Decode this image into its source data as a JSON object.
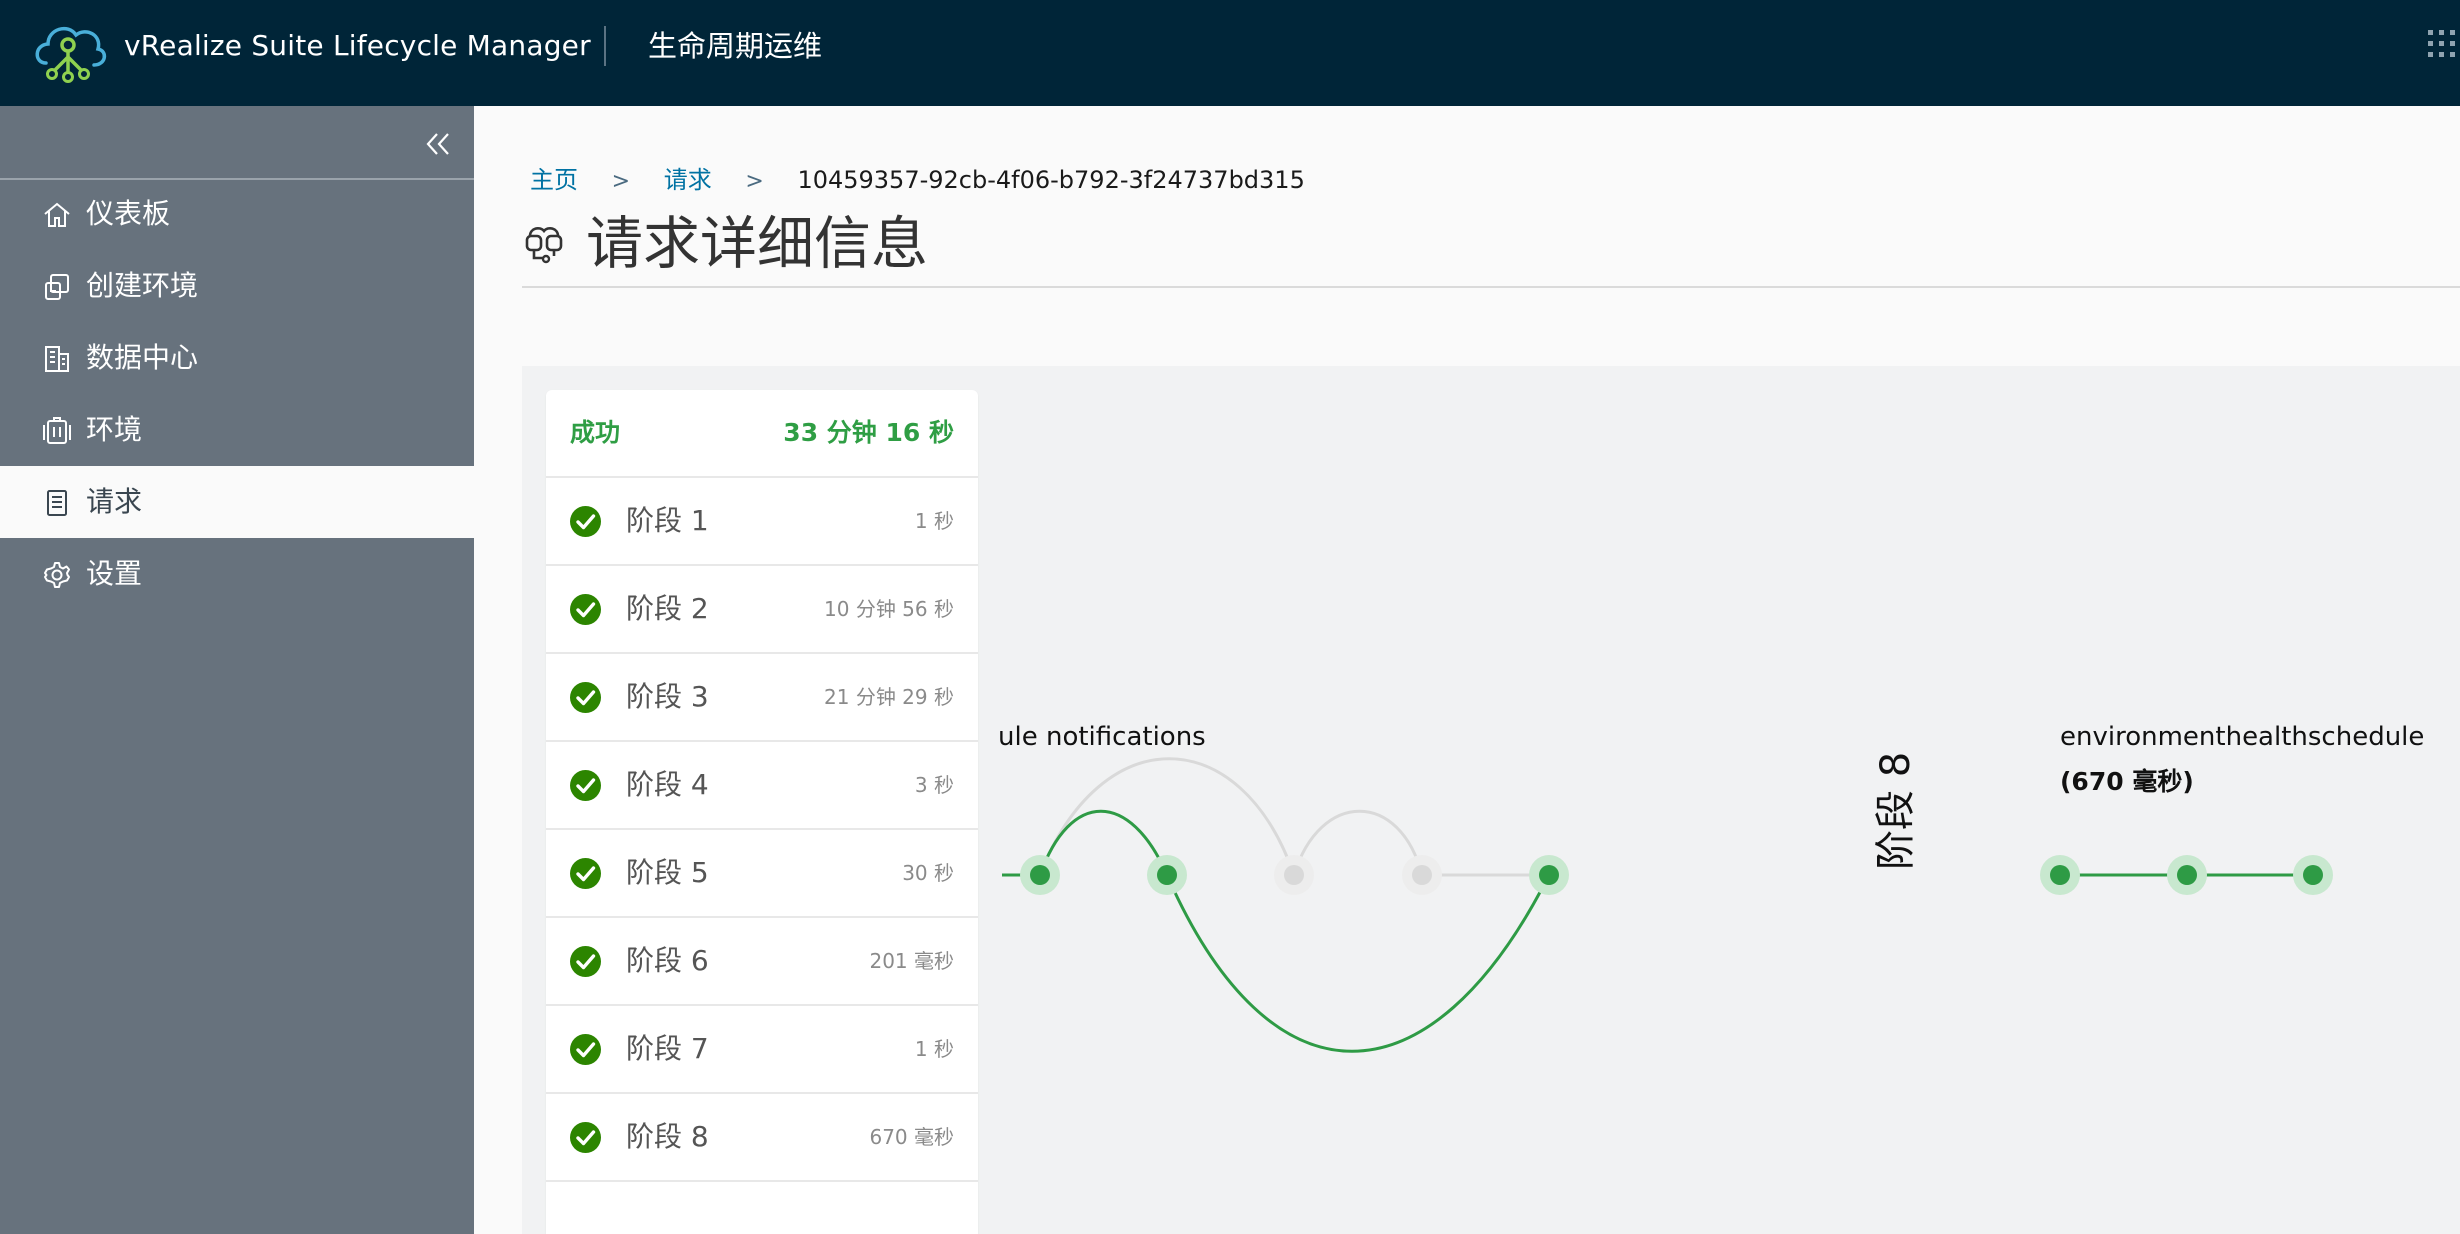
{
  "header": {
    "app_title": "vRealize Suite Lifecycle Manager",
    "section_title": "生命周期运维",
    "logo_icon": "cloud-network-logo-icon",
    "switcher_icon": "app-grid-icon"
  },
  "sidebar": {
    "collapse_icon": "double-chevron-left-icon",
    "items": [
      {
        "label": "仪表板",
        "icon": "home-icon",
        "active": false
      },
      {
        "label": "创建环境",
        "icon": "create-environment-icon",
        "active": false
      },
      {
        "label": "数据中心",
        "icon": "building-icon",
        "active": false
      },
      {
        "label": "环境",
        "icon": "environment-icon",
        "active": false
      },
      {
        "label": "请求",
        "icon": "document-list-icon",
        "active": true
      },
      {
        "label": "设置",
        "icon": "gear-icon",
        "active": false
      }
    ]
  },
  "breadcrumb": {
    "home": "主页",
    "requests": "请求",
    "current": "10459357-92cb-4f06-b792-3f24737bd315",
    "separator": ">"
  },
  "page": {
    "title": "请求详细信息",
    "title_icon": "request-details-icon"
  },
  "summary": {
    "status": "成功",
    "total_duration": "33 分钟 16 秒",
    "status_color": "#2f9e44"
  },
  "stages": [
    {
      "name": "阶段 1",
      "duration": "1 秒"
    },
    {
      "name": "阶段 2",
      "duration": "10 分钟 56 秒"
    },
    {
      "name": "阶段 3",
      "duration": "21 分钟 29 秒"
    },
    {
      "name": "阶段 4",
      "duration": "3 秒"
    },
    {
      "name": "阶段 5",
      "duration": "30 秒"
    },
    {
      "name": "阶段 6",
      "duration": "201 毫秒"
    },
    {
      "name": "阶段 7",
      "duration": "1 秒"
    },
    {
      "name": "阶段 8",
      "duration": "670 毫秒"
    }
  ],
  "graph": {
    "partial_label": "ule notifications",
    "stage8_label": "阶段 8",
    "stage8_task": "environmenthealthschedule",
    "stage8_task_duration": "(670 毫秒)",
    "colors": {
      "success": "#2e9b45",
      "success_halo": "#c8e8cf",
      "skipped": "#d9d9d9",
      "skipped_halo": "#ededed"
    }
  }
}
